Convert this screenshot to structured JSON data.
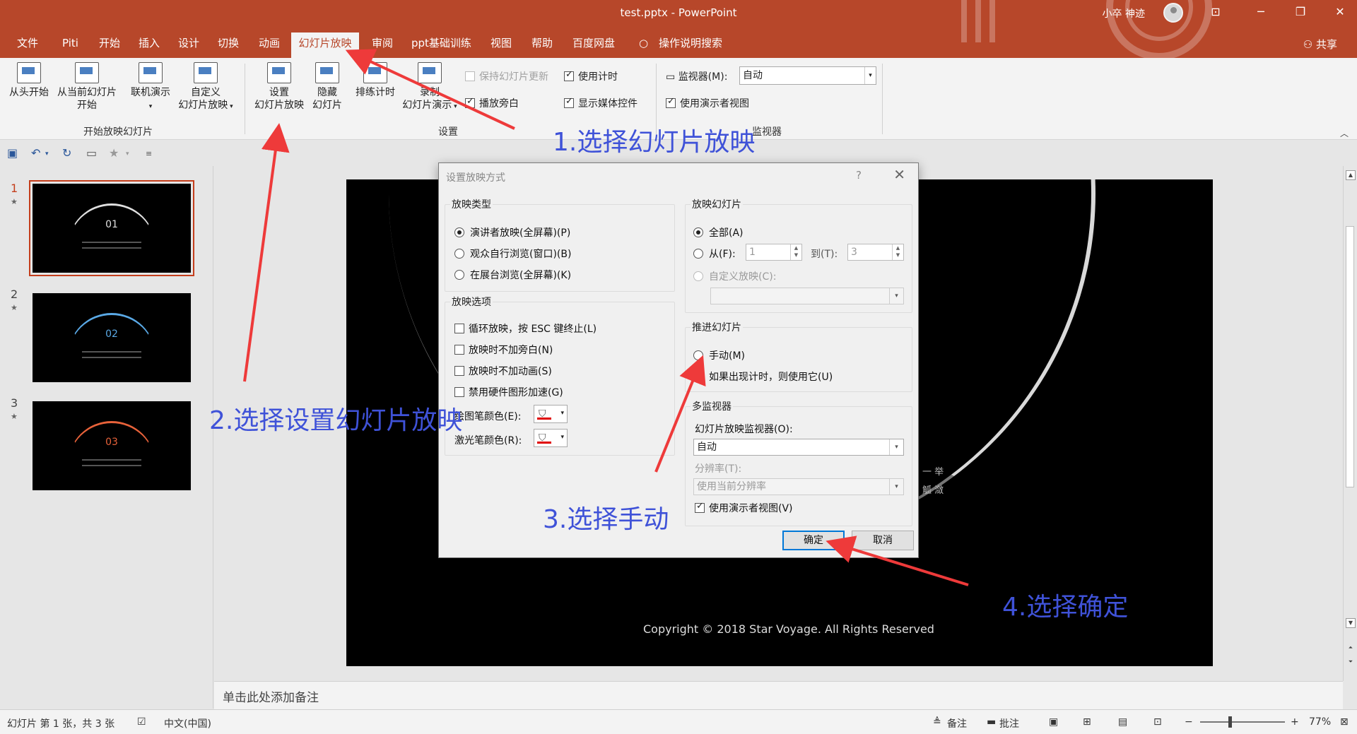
{
  "window": {
    "title": "test.pptx  -  PowerPoint",
    "user_name": "小卒 神迹",
    "share": "共享"
  },
  "tabs": [
    "文件",
    "Piti",
    "开始",
    "插入",
    "设计",
    "切换",
    "动画",
    "幻灯片放映",
    "审阅",
    "ppt基础训练",
    "视图",
    "帮助",
    "百度网盘",
    "操作说明搜索"
  ],
  "active_tab": "幻灯片放映",
  "ribbon": {
    "from_beginning": "从头开始",
    "from_current": "从当前幻灯片",
    "from_current_2": "开始",
    "online": "联机演示",
    "custom_1": "自定义",
    "custom_2": "幻灯片放映",
    "group_start": "开始放映幻灯片",
    "setup_1": "设置",
    "setup_2": "幻灯片放映",
    "hide_1": "隐藏",
    "hide_2": "幻灯片",
    "rehearse": "排练计时",
    "record_1": "录制",
    "record_2": "幻灯片演示",
    "keep_updated": "保持幻灯片更新",
    "play_narration": "播放旁白",
    "use_timings": "使用计时",
    "show_media": "显示媒体控件",
    "group_setup": "设置",
    "monitor_label": "监视器(M):",
    "monitor_value": "自动",
    "presenter_view": "使用演示者视图",
    "group_monitor": "监视器"
  },
  "slides": [
    {
      "number": "1",
      "label": "01",
      "accent": "#e0e0e0"
    },
    {
      "number": "2",
      "label": "02",
      "accent": "#5aa9e6"
    },
    {
      "number": "3",
      "label": "03",
      "accent": "#e8623a"
    }
  ],
  "slide_main": {
    "copyright": "Copyright © 2018 Star Voyage. All Rights Reserved",
    "side_text_1": "一 举",
    "side_text_2": "觚 潋"
  },
  "notes_placeholder": "单击此处添加备注",
  "status": {
    "slide_info": "幻灯片 第 1 张，共 3 张",
    "language": "中文(中国)",
    "notes": "备注",
    "comments": "批注",
    "zoom": "77%"
  },
  "dialog": {
    "title": "设置放映方式",
    "help": "?",
    "show_type_legend": "放映类型",
    "show_type_options": [
      "演讲者放映(全屏幕)(P)",
      "观众自行浏览(窗口)(B)",
      "在展台浏览(全屏幕)(K)"
    ],
    "show_options_legend": "放映选项",
    "show_options": [
      "循环放映，按 ESC 键终止(L)",
      "放映时不加旁白(N)",
      "放映时不加动画(S)",
      "禁用硬件图形加速(G)"
    ],
    "pen_color": "绘图笔颜色(E):",
    "laser_color": "激光笔颜色(R):",
    "slides_legend": "放映幻灯片",
    "all": "全部(A)",
    "from": "从(F):",
    "from_value": "1",
    "to": "到(T):",
    "to_value": "3",
    "custom_show": "自定义放映(C):",
    "advance_legend": "推进幻灯片",
    "manual": "手动(M)",
    "use_timings": "如果出现计时，则使用它(U)",
    "multi_legend": "多监视器",
    "monitor_label": "幻灯片放映监视器(O):",
    "monitor_value": "自动",
    "resolution_label": "分辨率(T):",
    "resolution_value": "使用当前分辨率",
    "presenter_view": "使用演示者视图(V)",
    "ok": "确定",
    "cancel": "取消"
  },
  "annotations": {
    "step1": "1.选择幻灯片放映",
    "step2": "2.选择设置幻灯片放映",
    "step3": "3.选择手动",
    "step4": "4.选择确定",
    "color": "#3f52d8",
    "arrow_color": "#ee3a3a"
  }
}
